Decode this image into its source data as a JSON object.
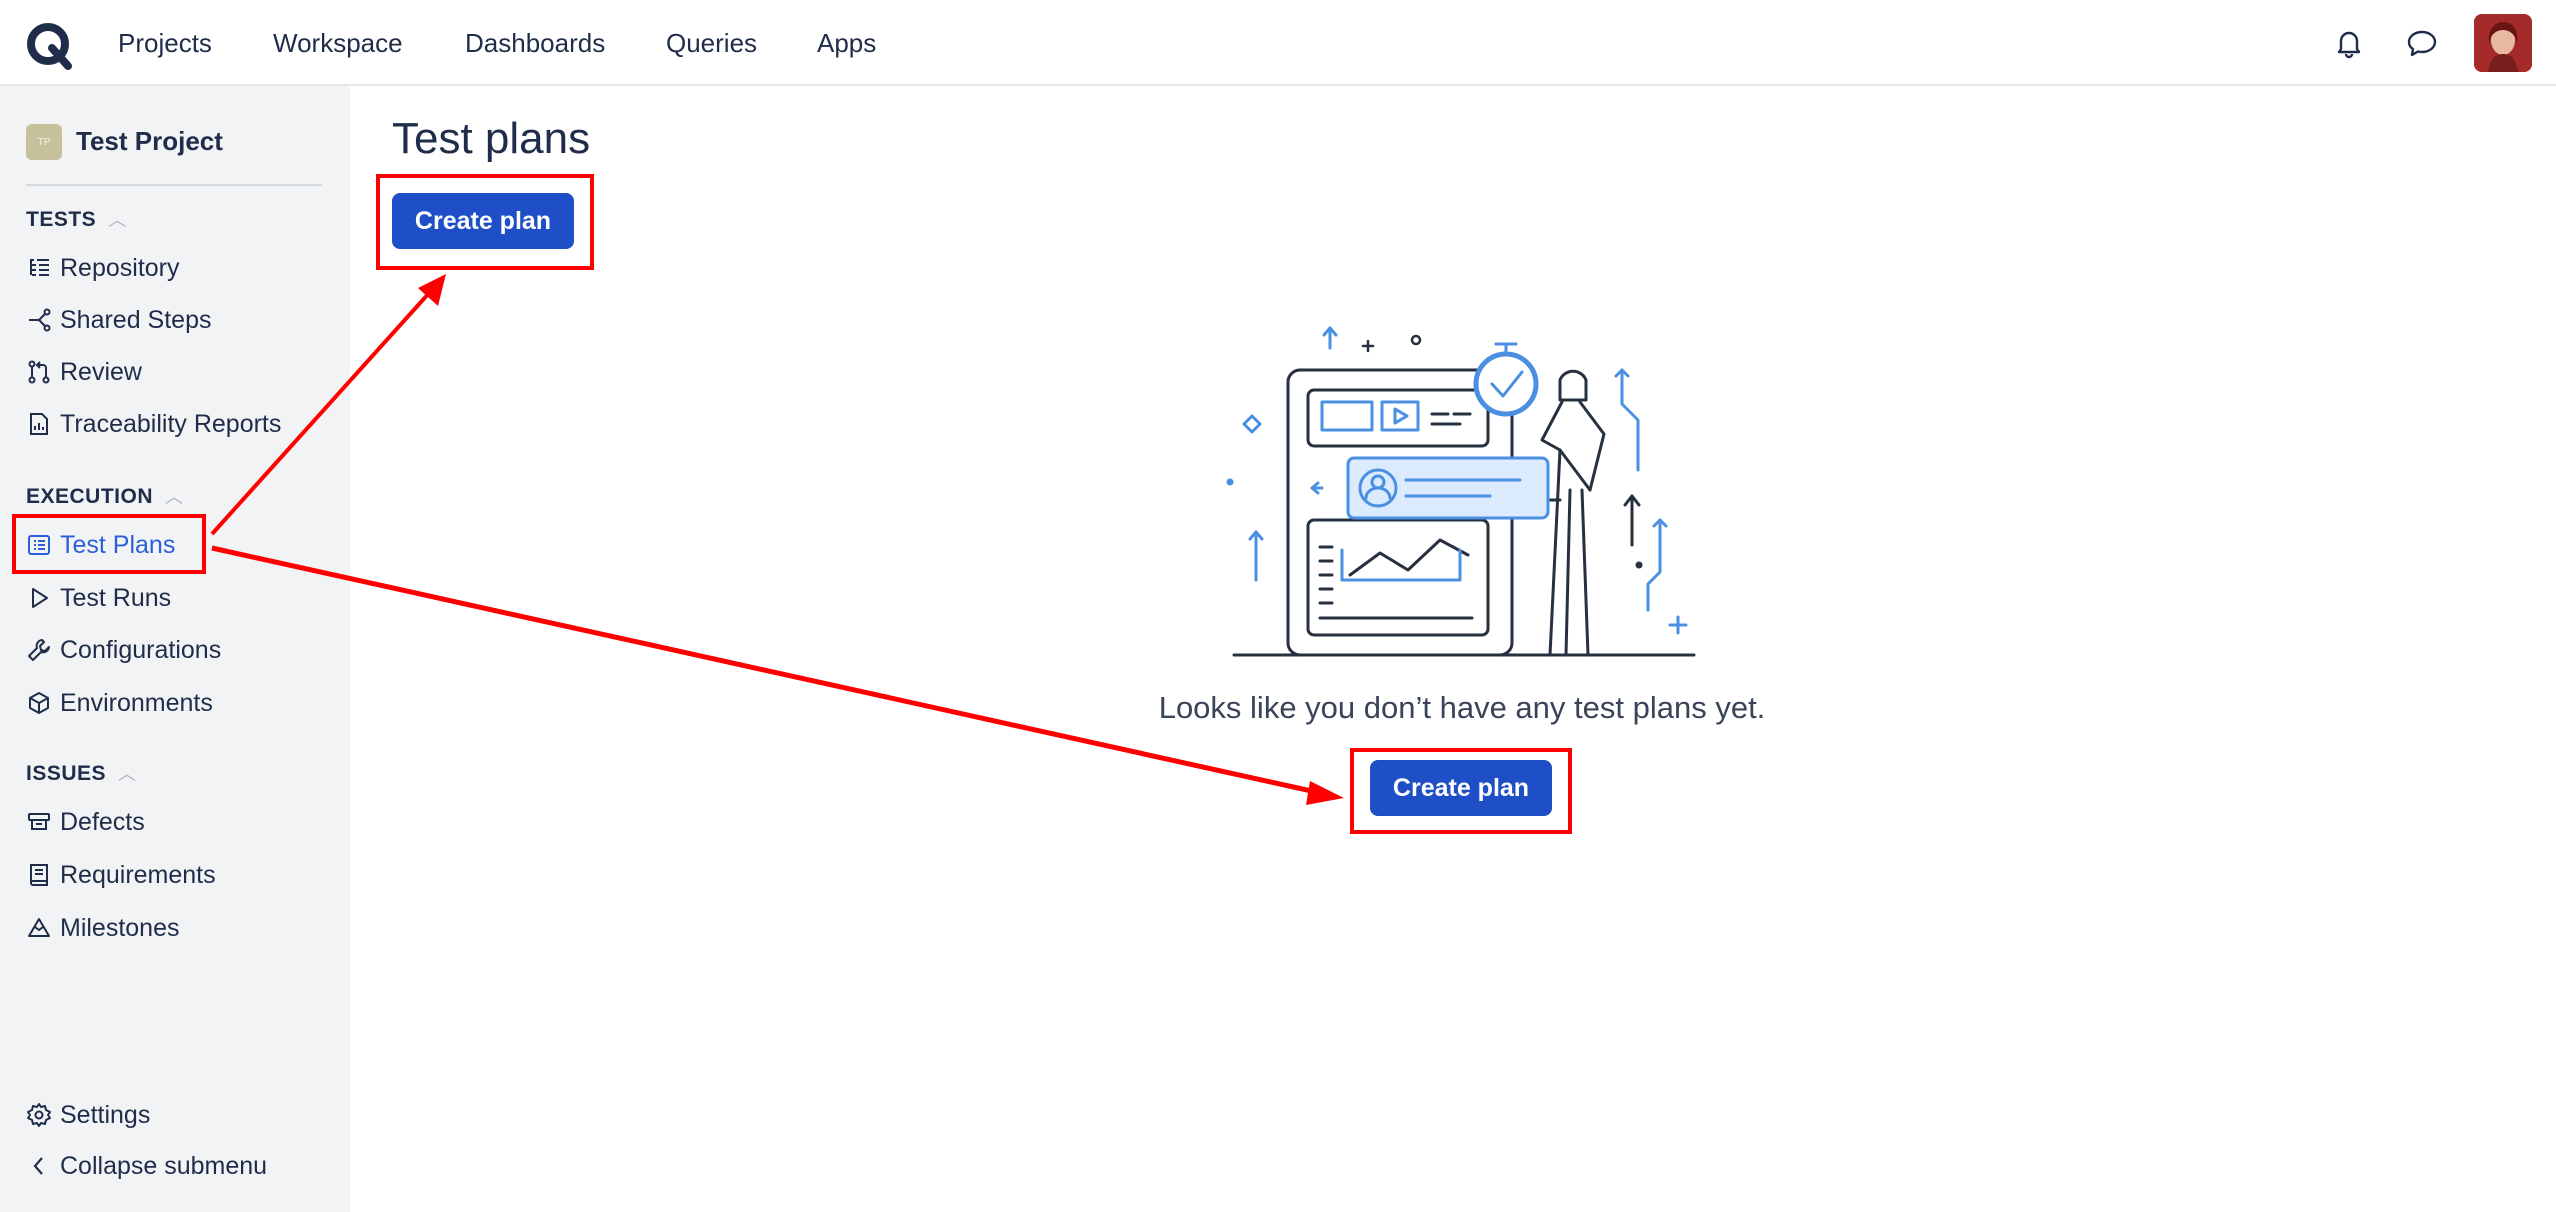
{
  "topbar": {
    "nav": [
      "Projects",
      "Workspace",
      "Dashboards",
      "Queries",
      "Apps"
    ],
    "icons": [
      "bell-icon",
      "chat-icon"
    ]
  },
  "sidebar": {
    "project_badge": "TP",
    "project_name": "Test Project",
    "sections": {
      "tests": {
        "title": "TESTS",
        "items": [
          "Repository",
          "Shared Steps",
          "Review",
          "Traceability Reports"
        ]
      },
      "execution": {
        "title": "EXECUTION",
        "items": [
          "Test Plans",
          "Test Runs",
          "Configurations",
          "Environments"
        ]
      },
      "issues": {
        "title": "ISSUES",
        "items": [
          "Defects",
          "Requirements",
          "Milestones"
        ]
      }
    },
    "active_item": "Test Plans",
    "footer": {
      "settings": "Settings",
      "collapse": "Collapse submenu"
    }
  },
  "main": {
    "title": "Test plans",
    "create_button": "Create plan",
    "empty_message": "Looks like you don’t have any test plans yet.",
    "empty_create_button": "Create plan"
  },
  "colors": {
    "primary": "#1f4fc6",
    "active_link": "#2b5fd9",
    "annotation": "#ff0000",
    "sidebar_bg": "#f2f3f5",
    "illustration_accent": "#4a90e2"
  }
}
